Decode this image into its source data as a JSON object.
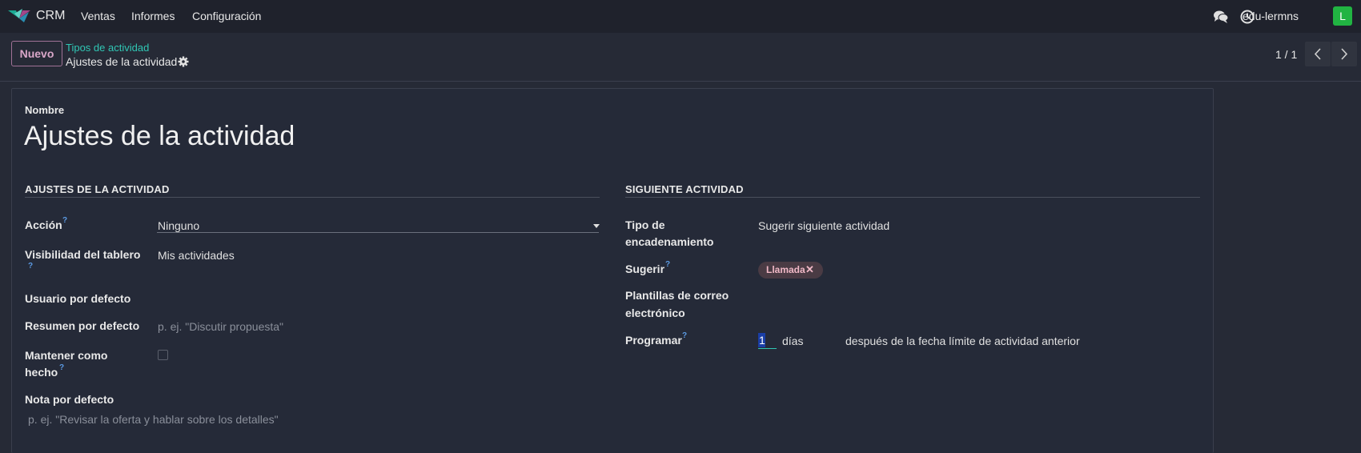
{
  "topnav": {
    "app_name": "CRM",
    "menu": [
      "Ventas",
      "Informes",
      "Configuración"
    ],
    "icons": [
      "chat-icon",
      "clock-icon"
    ],
    "username": "edu-lermns",
    "avatar_letter": "L"
  },
  "controlbar": {
    "new_label": "Nuevo",
    "breadcrumb_parent": "Tipos de actividad",
    "breadcrumb_current": "Ajustes de la actividad",
    "pager": "1 / 1"
  },
  "form": {
    "name_label": "Nombre",
    "name_value": "Ajustes de la actividad",
    "left_section": {
      "title": "AJUSTES DE LA ACTIVIDAD",
      "accion_label": "Acción",
      "accion_value": "Ninguno",
      "visibilidad_label": "Visibilidad del tablero",
      "visibilidad_value": "Mis actividades",
      "usuario_label": "Usuario por defecto",
      "resumen_label": "Resumen por defecto",
      "resumen_placeholder": "p. ej. \"Discutir propuesta\"",
      "mantener_label_1": "Mantener como",
      "mantener_label_2": "hecho",
      "mantener_checked": false,
      "nota_label": "Nota por defecto",
      "nota_placeholder": "p. ej. \"Revisar la oferta y hablar sobre los detalles\""
    },
    "right_section": {
      "title": "SIGUIENTE ACTIVIDAD",
      "tipo_label_1": "Tipo de",
      "tipo_label_2": "encadenamiento",
      "tipo_value": "Sugerir siguiente actividad",
      "sugerir_label": "Sugerir",
      "sugerir_tag": "Llamada",
      "plantillas_label_1": "Plantillas de correo",
      "plantillas_label_2": "electrónico",
      "programar_label": "Programar",
      "programar_value": "1",
      "programar_unit": "días",
      "programar_after": "después de la fecha límite de actividad anterior"
    },
    "help_mark": "?"
  },
  "colors": {
    "accent_teal": "#30c7b5",
    "new_button_border": "#a07296",
    "avatar_bg": "#21b442",
    "tag_bg": "#4a3b44"
  }
}
